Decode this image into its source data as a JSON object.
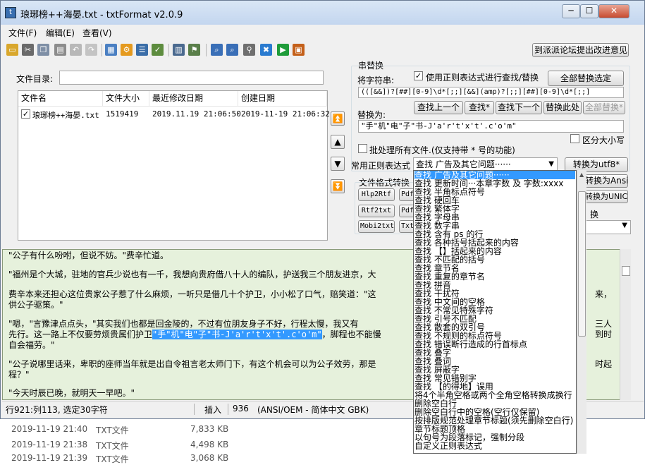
{
  "window": {
    "title": "琅琊榜++海晏.txt - txtFormat v2.0.9",
    "minimize_glyph": "─",
    "maximize_glyph": "☐",
    "close_glyph": "✕"
  },
  "menu": [
    "文件(F)",
    "编辑(E)",
    "查看(V)"
  ],
  "toolbar": {
    "icons": [
      "open-folder-icon",
      "cut-icon",
      "copy-icon",
      "paste-icon",
      "undo-icon",
      "redo-icon",
      "settings-gear-icon",
      "align-icon",
      "spellcheck-icon",
      "chart-icon",
      "bookmark-icon",
      "find-icon",
      "find-next-icon",
      "replace-icon",
      "tools-icon",
      "run-icon",
      "image-icon"
    ],
    "forum_button": "到派派论坛提出改进意见"
  },
  "file_panel": {
    "dir_label": "文件目录:",
    "dir_value": "",
    "columns": [
      "文件名",
      "文件大小",
      "最近修改日期",
      "创建日期"
    ],
    "rows": [
      {
        "checked": true,
        "name": "琅琊榜++海晏.txt",
        "size": "1519419",
        "modified": "2019.11.19 21:06:50",
        "created": "2019-11-19 21:06:32"
      }
    ]
  },
  "replace": {
    "group_title": "串替换",
    "find_label": "将字符串:",
    "use_regex_label": "使用正则表达式进行查找/替换",
    "use_regex_checked": true,
    "replace_all_button": "全部替换选定",
    "find_value": "(([&&])?[##][0-9]\\d*[;;][&&](amp)?[;;][##][0-9]\\d*[;;]",
    "prev_button": "查找上一个",
    "find_star_button": "查找*",
    "next_button": "查找下一个",
    "replace_here_button": "替换此处",
    "replace_all_star_button": "全部替换*",
    "replace_with_label": "替换为:",
    "replace_value": "\"手\"机\"电\"子\"书-J'a'r't'x't'.c'o'm\"",
    "case_label": "区分大小写",
    "case_checked": false,
    "batch_label": "批处理所有文件.(仅支持带 * 号的功能)",
    "batch_checked": false,
    "common_regex_label": "常用正则表达式",
    "common_regex_value": "查找 广告及其它问题······"
  },
  "convert": {
    "to_utf8_button": "转换为utf8*",
    "to_ansi_button": "转换为Ansi*",
    "to_unicode_button": "转换为UNICODE*",
    "format_label": "文件格式转换",
    "buttons": [
      "Hlp2Rtf",
      "Pdf",
      "Rtf2txt",
      "Pdf",
      "Mobi2txt",
      "Txt"
    ],
    "replace_label": "换"
  },
  "editor": {
    "lines": [
      "\"公子有什么吩咐，但说不妨。\"费辛忙道。",
      "\"福州是个大城，驻地的官兵少说也有一千，我想向贵府借八十人的编队，护送我三个朋友进京，大",
      "费辛本来还担心这位贵家公子惹了什么麻烦，一听只是借几十个护卫，小小松了口气，赔笑道：\"这",
      "供公子驱策。\"",
      "\"嗯，\"言豫津点点头，\"其实我们也都是回金陵的，不过有位朋友身子不好，行程太慢，我又有",
      "先行。这一路上不仅要劳烦贵属们护卫",
      "自会福劳。\"",
      "\"公子说哪里话来，卑职的座师当年就是出自令祖言老太师门下，有这个机会可以为公子效劳，那是",
      "程？\"",
      "\"今天时辰已晚，就明天一早吧。\""
    ],
    "selected": "\"手\"机\"电\"子\"书-J'a'r't'x't'.c'o'm\"",
    "after_selected": "，脚程也不能慢",
    "right_fragments": [
      "来，",
      "三人",
      "到时",
      "时起"
    ]
  },
  "statusbar": {
    "position": "行921:列113, 选定30字符",
    "mode": "插入",
    "count": "936",
    "encoding": "(ANSI/OEM - 简体中文 GBK)"
  },
  "explorer_behind": [
    {
      "date": "2019-11-19 21:40",
      "type": "TXT文件",
      "size": "7,833 KB"
    },
    {
      "date": "2019-11-19 21:38",
      "type": "TXT文件",
      "size": "4,498 KB"
    },
    {
      "date": "2019-11-19 21:39",
      "type": "TXT文件",
      "size": "3,068 KB"
    }
  ],
  "dropdown_items": [
    "查找 广告及其它问题······",
    "查找 更新时间···本章字数 及 字数:xxxx",
    "查找 半角标点符号",
    "查找 硬回车",
    "查找 繁体字",
    "查找 字母串",
    "查找 数字串",
    "查找 含有 ps 的行",
    "查找 各种括号括起来的内容",
    "查找 【】括起来的内容",
    "查找 不匹配的括号",
    "查找 章节名",
    "查找 重复的章节名",
    "查找 拼音",
    "查找 干扰符",
    "查找 中文间的空格",
    "查找 不常见特殊字符",
    "查找 引号不匹配",
    "查找 散套的双引号",
    "查找 不规则的标点符号",
    "查找 错误断行造成的行首标点",
    "查找 叠字",
    "查找 叠词",
    "查找 屏蔽字",
    "查找 常见错别字",
    "查找 【的得地】误用",
    "将4个半角空格或两个全角空格转换成换行",
    "删除空白行",
    "删除空白行中的空格(空行仅保留)",
    "按排版规范处理章节标题(须先删除空白行)",
    "章节标题顶格",
    "以句号为段落标记，强制分段",
    "自定义正则表达式"
  ],
  "colors": {
    "editor_bg": "#e6f1dc",
    "selection": "#3399ff",
    "titlebar": "#c3d6ef"
  }
}
